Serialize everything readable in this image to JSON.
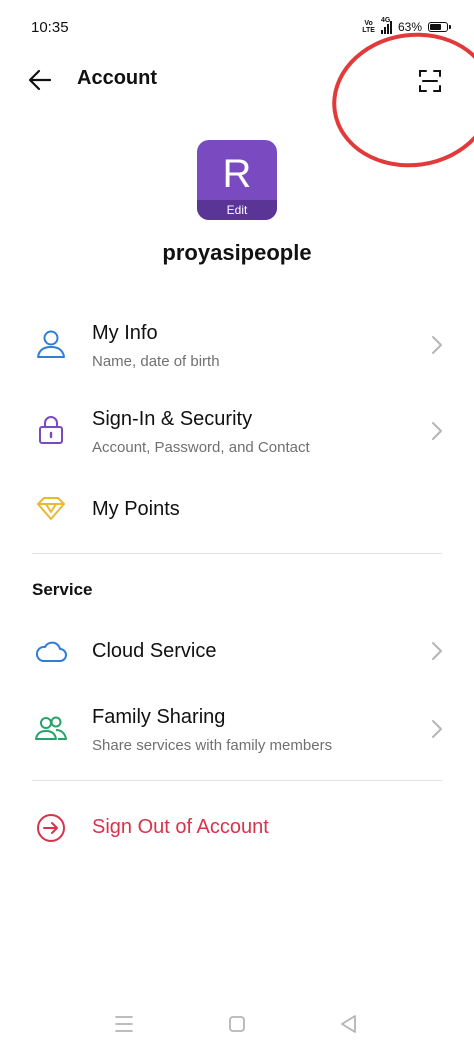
{
  "status_bar": {
    "time": "10:35",
    "volte_top": "Vo",
    "volte_bottom": "LTE",
    "network": "4G",
    "battery": "63%"
  },
  "header": {
    "title": "Account",
    "back_icon": "arrow-left-icon",
    "scan_icon": "scan-frame-icon",
    "annotation_color": "#e23a3a"
  },
  "profile": {
    "avatar_letter": "R",
    "avatar_edit_label": "Edit",
    "avatar_color": "#7a4bc0",
    "username": "proyasipeople"
  },
  "account_items": [
    {
      "title": "My Info",
      "subtitle": "Name, date of birth",
      "icon": "person-icon",
      "color": "#2f7fd6"
    },
    {
      "title": "Sign-In & Security",
      "subtitle": "Account, Password, and Contact",
      "icon": "lock-icon",
      "color": "#7a4bc0"
    },
    {
      "title": "My Points",
      "subtitle": "",
      "icon": "diamond-icon",
      "color": "#e9b92e"
    }
  ],
  "service_section": {
    "label": "Service",
    "items": [
      {
        "title": "Cloud Service",
        "subtitle": "",
        "icon": "cloud-icon",
        "color": "#2f7fd6"
      },
      {
        "title": "Family Sharing",
        "subtitle": "Share services with family members",
        "icon": "family-icon",
        "color": "#27a36a"
      }
    ]
  },
  "sign_out": {
    "label": "Sign Out of Account",
    "icon": "sign-out-arrow-icon",
    "color": "#d8334a"
  },
  "nav_bar": {
    "menu_icon": "menu-icon",
    "home_icon": "home-square-icon",
    "back_icon": "back-triangle-icon"
  }
}
